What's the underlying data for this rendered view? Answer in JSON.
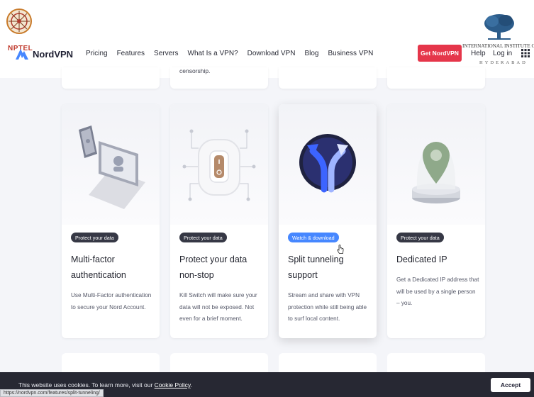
{
  "overlay": {
    "nptel_label": "NPTEL",
    "iiit_name": "INTERNATIONAL INSTITUTE OF INFORMATION TECHNOLOGY",
    "iiit_city": "HYDERABAD"
  },
  "header": {
    "brand": "NordVPN",
    "brand_mark": "®",
    "nav": [
      "Pricing",
      "Features",
      "Servers",
      "What Is a VPN?",
      "Download VPN",
      "Blog",
      "Business VPN"
    ],
    "cta": "Get NordVPN",
    "help": "Help",
    "login": "Log in"
  },
  "top_cards": [
    {
      "text": ""
    },
    {
      "text": "censorship."
    },
    {
      "text": ""
    },
    {
      "text": ""
    }
  ],
  "cards": [
    {
      "badge": "Protect your data",
      "title": "Multi-factor authentication",
      "desc": "Use Multi-Factor authentication to secure your Nord Account.",
      "illustration": "laptop-phone-icon"
    },
    {
      "badge": "Protect your data",
      "title": "Protect your data non-stop",
      "desc": "Kill Switch will make sure your data will not be exposed. Not even for a brief moment.",
      "illustration": "kill-switch-icon"
    },
    {
      "badge": "Watch & download",
      "title": "Split tunneling support",
      "desc": "Stream and share with VPN protection while still being able to surf local content.",
      "illustration": "split-arrow-icon"
    },
    {
      "badge": "Protect your data",
      "title": "Dedicated IP",
      "desc": "Get a Dedicated IP address that will be used by a single person – you.",
      "illustration": "location-pin-icon"
    }
  ],
  "cookie": {
    "text": "This website uses cookies. To learn more, visit our ",
    "link": "Cookie Policy",
    "suffix": ".",
    "accept": "Accept"
  },
  "status_url": "https://nordvpn.com/features/split-tunneling/",
  "colors": {
    "accent_red": "#e5364a",
    "badge_dark": "#363845",
    "badge_blue": "#4687ff",
    "cookie_bg": "#272833"
  }
}
